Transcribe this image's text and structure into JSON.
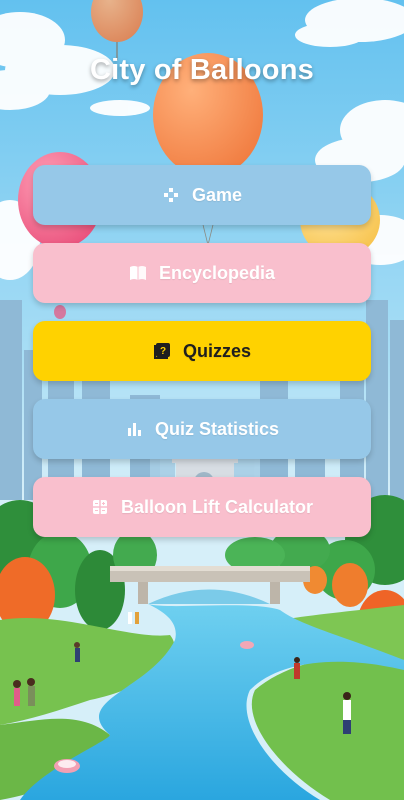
{
  "app": {
    "title": "City of Balloons"
  },
  "menu": [
    {
      "id": "game",
      "label": "Game",
      "icon": "gamepad-icon",
      "color": "#96c8e8"
    },
    {
      "id": "encyclopedia",
      "label": "Encyclopedia",
      "icon": "book-icon",
      "color": "#f9bfcd"
    },
    {
      "id": "quizzes",
      "label": "Quizzes",
      "icon": "quiz-icon",
      "color": "#ffd200"
    },
    {
      "id": "quiz-statistics",
      "label": "Quiz Statistics",
      "icon": "bar-chart-icon",
      "color": "#96c8e8"
    },
    {
      "id": "balloon-lift-calculator",
      "label": "Balloon Lift Calculator",
      "icon": "calculator-icon",
      "color": "#f9bfcd"
    }
  ]
}
